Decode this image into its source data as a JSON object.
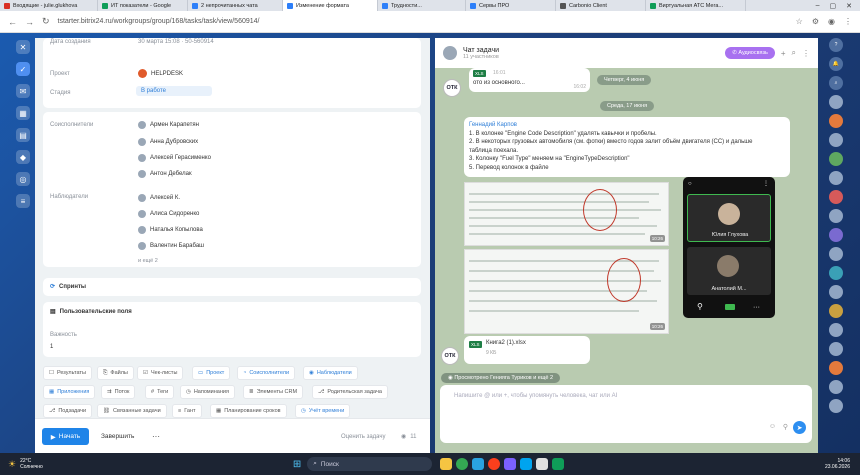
{
  "browser": {
    "tabs": [
      {
        "label": "Входящие - julie.glukhova",
        "color": "#d93025"
      },
      {
        "label": "ИТ показатели - Google",
        "color": "#0f9d58"
      },
      {
        "label": "2 непрочитанных чата",
        "color": "#2d7ff9"
      },
      {
        "label": "Изменение формата",
        "color": "#2d7ff9"
      },
      {
        "label": "Трудности...",
        "color": "#2d7ff9"
      },
      {
        "label": "Сервы ПРО",
        "color": "#2d7ff9"
      },
      {
        "label": "Carbonio Client",
        "color": "#555555"
      },
      {
        "label": "Виртуальная АТС Мега...",
        "color": "#0f9d58"
      }
    ],
    "url": "tstarter.bitrix24.ru/workgroups/group/168/tasks/task/view/560914/"
  },
  "task": {
    "deadline_label": "Дата создания",
    "deadline_value": "30 марта 15:08 · 50-560914",
    "project_label": "Проект",
    "project_value": "HELPDESK",
    "stage_label": "Стадия",
    "stage_value": "В работе",
    "coexec_label": "Соисполнители",
    "coexec": [
      "Армен Карапетян",
      "Анна Дубровских",
      "Алексей Герасименко",
      "Антон Дебелак"
    ],
    "observers_label": "Наблюдатели",
    "observers": [
      "Алексей К.",
      "Алиса Сидоренко",
      "Наталья Копылова",
      "Валентин Барабаш"
    ],
    "more": "и ещё 2",
    "sprints": "Спринты",
    "custom_fields": "Пользовательские поля",
    "importance_label": "Важность",
    "importance_value": "1",
    "chips_row1": [
      "Результаты",
      "Файлы",
      "Чек-листы",
      "Проект",
      "Соисполнители",
      "Наблюдатели"
    ],
    "chips_row2": [
      "Приложения",
      "Поток",
      "Теги",
      "Напоминания",
      "Элементы CRM",
      "Родительская задача"
    ],
    "chips_row3": [
      "Подзадачи",
      "Связанные задачи",
      "Гант",
      "Планирование сроков",
      "Учёт времени"
    ],
    "start_button": "Начать",
    "finish_button": "Завершить",
    "more_button": "···",
    "rate": "Оценить задачу",
    "views": "11"
  },
  "chat": {
    "title": "Чат задачи",
    "participants": "11 участников",
    "audio_button": "Аудиосвязь",
    "top_time": "16:01",
    "top_text": "ото из основного...",
    "top_time2": "16:02",
    "date1": "Четверг, 4 июня",
    "date2": "Среда, 17 июня",
    "author": "Геннадий Карпов",
    "lines": [
      "1. В колонке \"Engine Code Description\" удалять кавычки и пробелы.",
      "2. В некоторых грузовых автомобиля (см. фотки) вместо годов залит объём двигателя (CC) и дальше",
      "таблица поехала.",
      "3. Колонку \"Fuel Type\" меняем на \"EngineTypeDescription\"",
      "5. Перевод колонок в файле"
    ],
    "img_time1": "10:26",
    "img_time2": "10:26",
    "file_name": "Книга2 (1).xlsx",
    "file_size": "9 КБ",
    "viewed": "Просмотрено Генияга Туриков и ещё 2",
    "placeholder": "Напишите @ или +, чтобы упомянуть человека, чат или AI",
    "avatar_text": "ОТК"
  },
  "video": {
    "p1": "Юлия Глухова",
    "p2": "Анатолий М..."
  },
  "taskbar": {
    "temp": "22°C",
    "weather": "Солнечно",
    "search": "Поиск",
    "time": "14:06",
    "date": "23.06.2026"
  }
}
